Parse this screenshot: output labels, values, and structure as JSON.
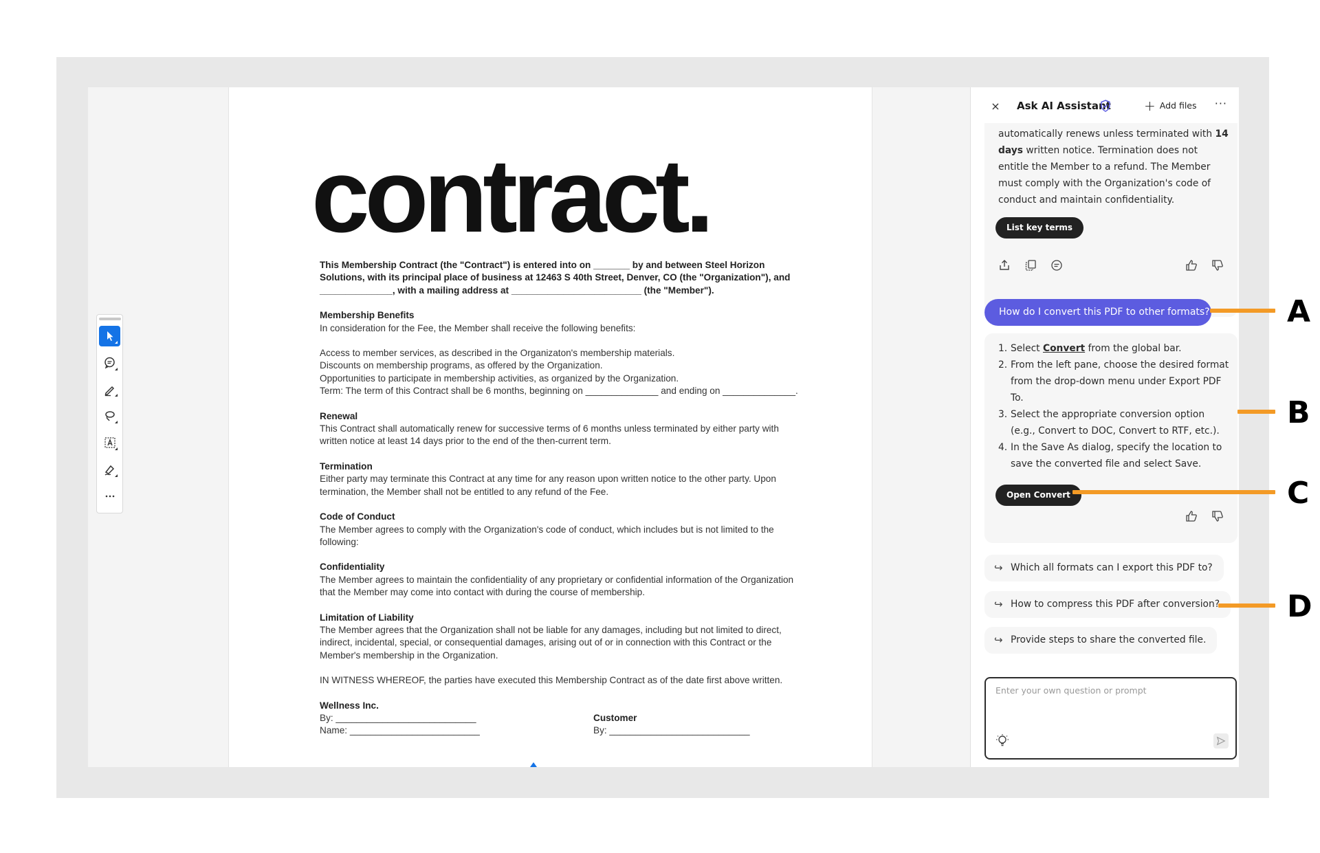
{
  "document": {
    "title": "contract.",
    "intro": "This Membership Contract (the \"Contract\") is entered into on _______ by and between Steel Horizon Solutions, with its principal place of business at 12463 S 40th Street, Denver, CO (the \"Organization\"), and ______________, with a mailing address at _________________________ (the \"Member\").",
    "sections": [
      {
        "heading": "Membership Benefits",
        "body": "In consideration for the Fee, the Member shall receive the following benefits:"
      },
      {
        "heading": "Renewal",
        "body": "This Contract shall automatically renew for successive terms of 6 months unless terminated by either party with written notice at least 14 days prior to the end of the then-current term."
      },
      {
        "heading": "Termination",
        "body": "Either party may terminate this Contract at any time for any reason upon written notice to the other party. Upon termination, the Member shall not be entitled to any refund of the Fee."
      },
      {
        "heading": "Code of Conduct",
        "body": "The Member agrees to comply with the Organization's code of conduct, which includes but is not limited to the following:"
      },
      {
        "heading": "Confidentiality",
        "body": "The Member agrees to maintain the confidentiality of any proprietary or confidential information of the Organization that the Member may come into contact with during the course of membership."
      },
      {
        "heading": "Limitation of Liability",
        "body": "The Member agrees that the Organization shall not be liable for any damages, including but not limited to direct, indirect, incidental, special, or consequential damages, arising out of or in connection with this Contract or the Member's membership in the Organization."
      }
    ],
    "benefits": [
      "Access to member services, as described in the Organizaton's membership materials.",
      "Discounts on membership programs, as offered by the Organization.",
      "Opportunities to participate in membership activities, as organized by the Organization.",
      "Term: The term of this Contract shall be 6 months, beginning on ______________ and ending on ______________."
    ],
    "witness": "IN WITNESS WHEREOF, the parties have executed this Membership Contract as of the date first above written.",
    "sig_left_heading": "Wellness Inc.",
    "sig_left_by": "By: ___________________________",
    "sig_left_name": "Name: _________________________",
    "sig_right_heading": "Customer",
    "sig_right_by": "By: ___________________________"
  },
  "panel": {
    "close": "×",
    "title": "Ask AI Assistant",
    "add_files": "Add files",
    "more": "···",
    "card1_pre": "automatically renews unless terminated with ",
    "card1_bold": "14 days",
    "card1_post": " written notice. Termination does not entitle the Member to a refund. The Member must comply with the Organization's code of conduct and maintain confidentiality.",
    "card1_button": "List key terms",
    "user_question": "How do I convert this PDF to other formats?",
    "steps": [
      {
        "num": "1.",
        "pre": "Select ",
        "link": "Convert",
        "post": " from the global bar."
      },
      {
        "num": "2.",
        "pre": "From the left pane, choose the desired format from the drop-down menu under Export PDF To.",
        "link": "",
        "post": ""
      },
      {
        "num": "3.",
        "pre": "Select the appropriate conversion option (e.g., Convert to DOC, Convert to RTF, etc.).",
        "link": "",
        "post": ""
      },
      {
        "num": "4.",
        "pre": "In the Save As dialog, specify the location to save the converted file and select Save.",
        "link": "",
        "post": ""
      }
    ],
    "card2_button": "Open Convert",
    "suggestions": [
      "Which all formats can I export this PDF to?",
      "How to compress this PDF after conversion?",
      "Provide steps to share the converted file."
    ],
    "prompt_placeholder": "Enter your own question or prompt"
  },
  "callouts": [
    "A",
    "B",
    "C",
    "D"
  ],
  "colors": {
    "accent": "#1473e6",
    "user_bubble": "#5c5ce0",
    "callout_line": "#f39a26",
    "pill": "#222222"
  }
}
